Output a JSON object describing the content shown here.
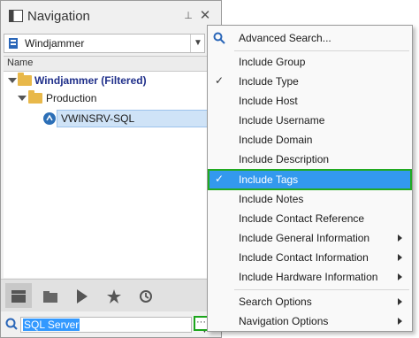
{
  "panel": {
    "title": "Navigation",
    "pin_glyph": "⊥",
    "close_glyph": "✕",
    "datasource": "Windjammer",
    "column_header": "Name"
  },
  "tree": {
    "root_label": "Windjammer (Filtered)",
    "group_label": "Production",
    "session_label": "VWINSRV-SQL"
  },
  "toolbar": {
    "icons": [
      "navigation-icon",
      "folder-icon",
      "play-icon",
      "star-icon",
      "history-icon"
    ]
  },
  "search": {
    "value": "SQL Server",
    "more_label": "···"
  },
  "menu": {
    "items": [
      {
        "label": "Advanced Search...",
        "checked": false,
        "submenu": false
      },
      {
        "label": "Include Group",
        "checked": false,
        "submenu": false
      },
      {
        "label": "Include Type",
        "checked": true,
        "submenu": false
      },
      {
        "label": "Include Host",
        "checked": false,
        "submenu": false
      },
      {
        "label": "Include Username",
        "checked": false,
        "submenu": false
      },
      {
        "label": "Include Domain",
        "checked": false,
        "submenu": false
      },
      {
        "label": "Include Description",
        "checked": false,
        "submenu": false
      },
      {
        "label": "Include Tags",
        "checked": true,
        "submenu": false
      },
      {
        "label": "Include Notes",
        "checked": false,
        "submenu": false
      },
      {
        "label": "Include Contact Reference",
        "checked": false,
        "submenu": false
      },
      {
        "label": "Include General Information",
        "checked": false,
        "submenu": true
      },
      {
        "label": "Include Contact Information",
        "checked": false,
        "submenu": true
      },
      {
        "label": "Include Hardware Information",
        "checked": false,
        "submenu": true
      },
      {
        "label": "Search Options",
        "checked": false,
        "submenu": true
      },
      {
        "label": "Navigation Options",
        "checked": false,
        "submenu": true
      }
    ],
    "check_glyph": "✓"
  },
  "colors": {
    "highlight": "#3399ee",
    "highlight_border": "#22aa22",
    "root_text": "#1f2f8a",
    "folder": "#e8b84a"
  }
}
